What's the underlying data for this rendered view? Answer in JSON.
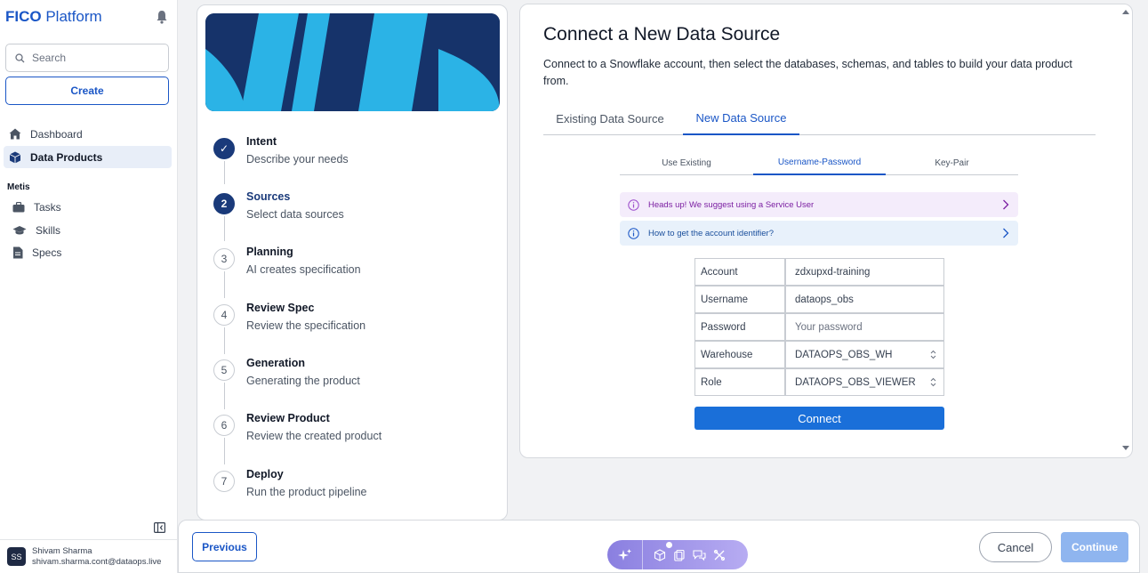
{
  "brand": {
    "primary": "FICO",
    "secondary": "Platform"
  },
  "sidebar": {
    "search_placeholder": "Search",
    "create_label": "Create",
    "nav": [
      {
        "label": "Dashboard",
        "icon": "home-icon"
      },
      {
        "label": "Data Products",
        "icon": "cube-icon"
      }
    ],
    "section_label": "Metis",
    "section_items": [
      {
        "label": "Tasks",
        "icon": "briefcase-icon"
      },
      {
        "label": "Skills",
        "icon": "graduation-cap-icon"
      },
      {
        "label": "Specs",
        "icon": "document-icon"
      }
    ],
    "user": {
      "initials": "SS",
      "name": "Shivam Sharma",
      "email": "shivam.sharma.cont@dataops.live"
    }
  },
  "steps": [
    {
      "num": "✓",
      "title": "Intent",
      "desc": "Describe your needs",
      "state": "done"
    },
    {
      "num": "2",
      "title": "Sources",
      "desc": "Select data sources",
      "state": "current"
    },
    {
      "num": "3",
      "title": "Planning",
      "desc": "AI creates specification",
      "state": "todo"
    },
    {
      "num": "4",
      "title": "Review Spec",
      "desc": "Review the specification",
      "state": "todo"
    },
    {
      "num": "5",
      "title": "Generation",
      "desc": "Generating the product",
      "state": "todo"
    },
    {
      "num": "6",
      "title": "Review Product",
      "desc": "Review the created product",
      "state": "todo"
    },
    {
      "num": "7",
      "title": "Deploy",
      "desc": "Run the product pipeline",
      "state": "todo"
    }
  ],
  "main": {
    "title": "Connect a New Data Source",
    "description": "Connect to a Snowflake account, then select the databases, schemas, and tables to build your data product from.",
    "tabs": [
      {
        "label": "Existing Data Source",
        "active": false
      },
      {
        "label": "New Data Source",
        "active": true
      }
    ],
    "subtabs": [
      {
        "label": "Use Existing",
        "active": false
      },
      {
        "label": "Username-Password",
        "active": true
      },
      {
        "label": "Key-Pair",
        "active": false
      }
    ],
    "alerts": [
      {
        "text": "Heads up! We suggest using a Service User"
      },
      {
        "text": "How to get the account identifier?"
      }
    ],
    "form": [
      {
        "label": "Account",
        "value": "zdxupxd-training",
        "kind": "text"
      },
      {
        "label": "Username",
        "value": "dataops_obs",
        "kind": "text"
      },
      {
        "label": "Password",
        "value": "Your password",
        "kind": "placeholder"
      },
      {
        "label": "Warehouse",
        "value": "DATAOPS_OBS_WH",
        "kind": "select"
      },
      {
        "label": "Role",
        "value": "DATAOPS_OBS_VIEWER",
        "kind": "select"
      }
    ],
    "connect_label": "Connect"
  },
  "footer": {
    "previous_label": "Previous",
    "cancel_label": "Cancel",
    "continue_label": "Continue"
  },
  "colors": {
    "accent": "#1a56c6",
    "step_active": "#1a3a7a",
    "connect": "#1a6fd9",
    "continue_disabled": "#8fb5ef"
  }
}
